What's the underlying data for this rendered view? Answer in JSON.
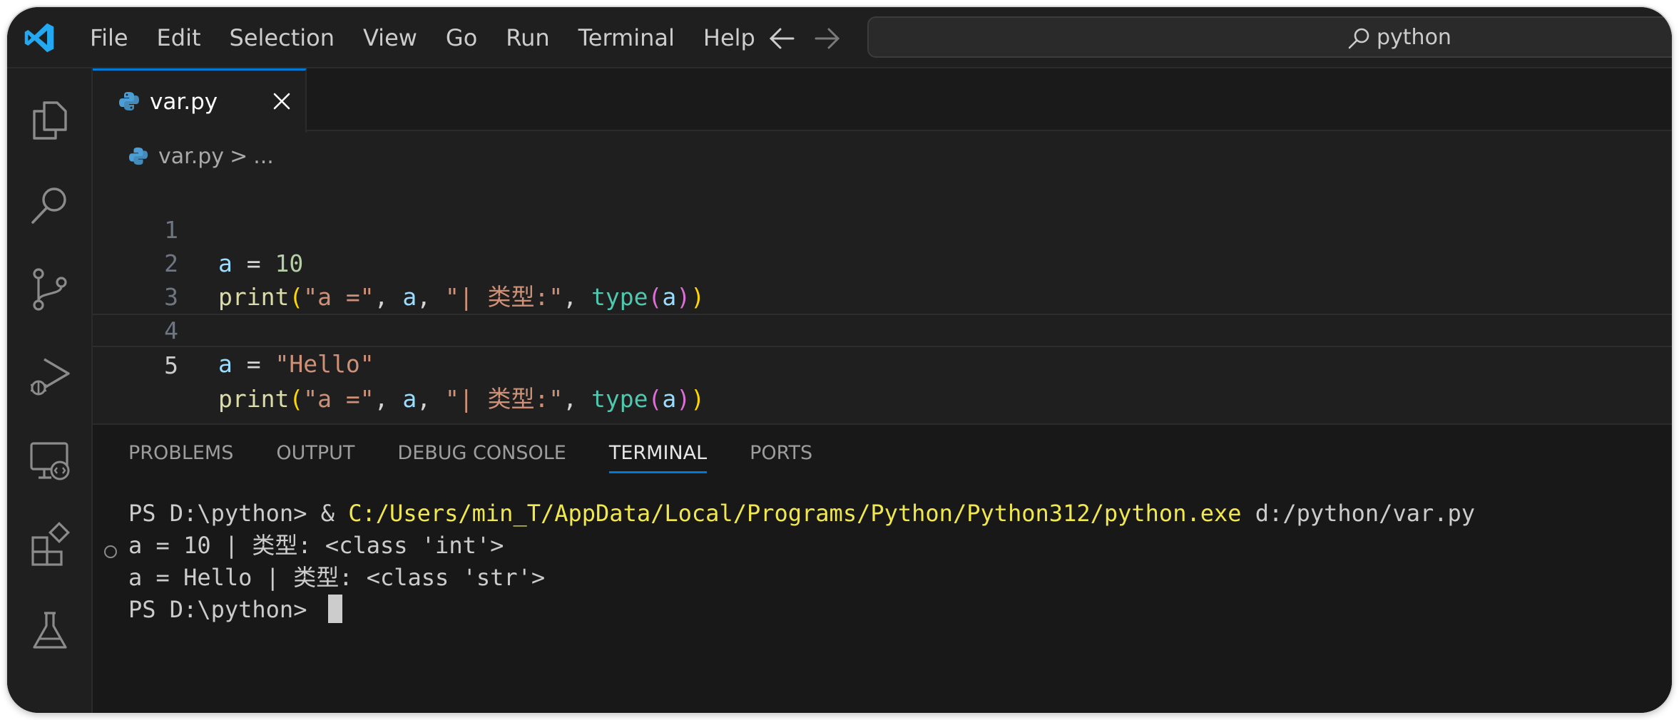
{
  "menu": [
    "File",
    "Edit",
    "Selection",
    "View",
    "Go",
    "Run",
    "Terminal",
    "Help"
  ],
  "search": {
    "text": "python"
  },
  "tab": {
    "label": "var.py"
  },
  "breadcrumb": {
    "file": "var.py",
    "sep": ">",
    "rest": "..."
  },
  "editor": {
    "line_numbers": [
      "1",
      "2",
      "3",
      "4",
      "5"
    ],
    "lines": [
      {
        "var": "a",
        "eq": " = ",
        "num": "10"
      },
      {
        "fn": "print",
        "p1": "(",
        "s1": "\"a =\"",
        "c1": ", ",
        "var": "a",
        "c2": ", ",
        "s2": "\"| 类型:\"",
        "c3": ", ",
        "builtin": "type",
        "p2": "(",
        "arg": "a",
        "p3": ")",
        "p4": ")"
      },
      {},
      {
        "var": "a",
        "eq": " = ",
        "str": "\"Hello\""
      },
      {
        "fn": "print",
        "p1": "(",
        "s1": "\"a =\"",
        "c1": ", ",
        "var": "a",
        "c2": ", ",
        "s2": "\"| 类型:\"",
        "c3": ", ",
        "builtin": "type",
        "p2": "(",
        "arg": "a",
        "p3": ")",
        "p4": ")"
      }
    ]
  },
  "panel": {
    "tabs": [
      "PROBLEMS",
      "OUTPUT",
      "DEBUG CONSOLE",
      "TERMINAL",
      "PORTS"
    ],
    "active_tab": "TERMINAL"
  },
  "terminal": {
    "prompt1": "PS D:\\python> & ",
    "exe": "C:/Users/min_T/AppData/Local/Programs/Python/Python312/python.exe",
    "arg": " d:/python/var.py",
    "out1": "a = 10 | 类型: <class 'int'>",
    "out2": "a = Hello | 类型: <class 'str'>",
    "prompt2": "PS D:\\python> "
  },
  "colors": {
    "accent": "#0078d4",
    "background": "#1f1f1f",
    "panel_background": "#181818",
    "terminal_path": "#f0e84d"
  },
  "icons": {
    "logo": "vscode-logo",
    "back": "arrow-left-icon",
    "forward": "arrow-right-icon",
    "search": "search-icon",
    "activity": [
      "explorer-icon",
      "search-icon",
      "source-control-icon",
      "run-debug-icon",
      "remote-explorer-icon",
      "extensions-icon",
      "testing-icon"
    ]
  }
}
